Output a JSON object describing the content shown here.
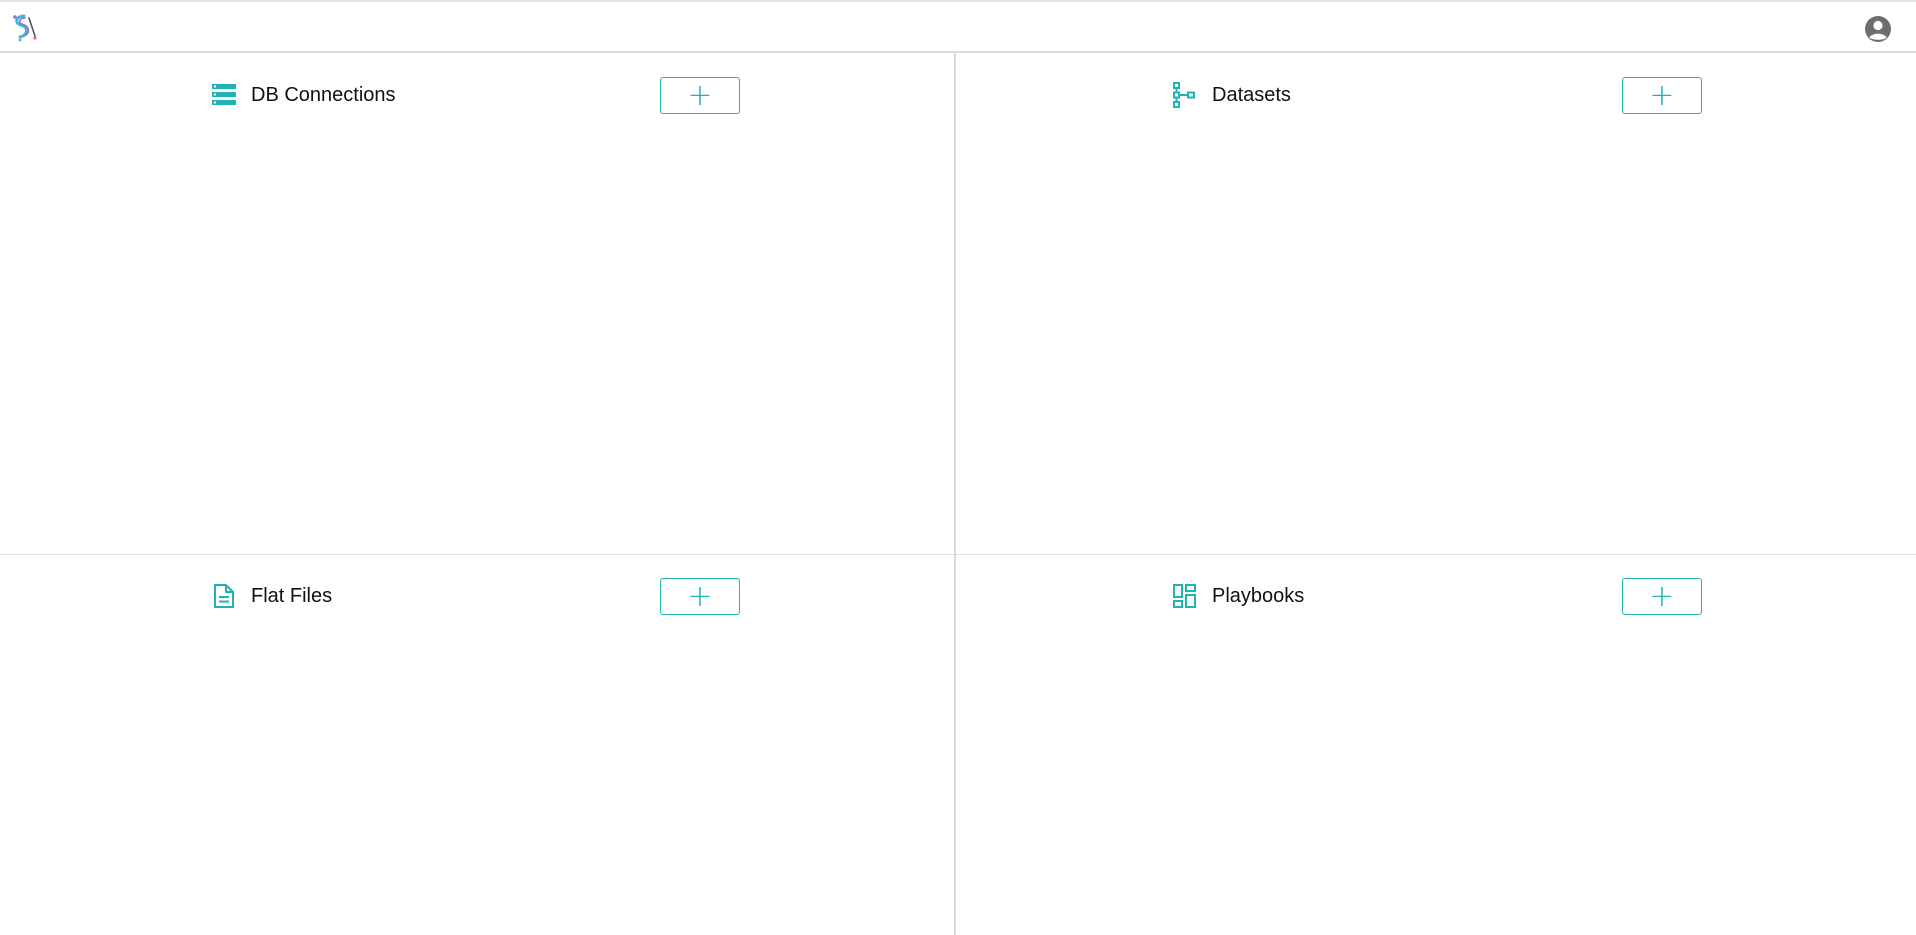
{
  "header": {
    "logo_icon": "app-logo",
    "user_icon": "user-account-icon",
    "accent_color": "#21b3b3"
  },
  "panels": [
    {
      "title": "DB Connections",
      "icon": "database-list-icon",
      "add_label": "+"
    },
    {
      "title": "Datasets",
      "icon": "hierarchy-tree-icon",
      "add_label": "+"
    },
    {
      "title": "Flat Files",
      "icon": "document-icon",
      "add_label": "+"
    },
    {
      "title": "Playbooks",
      "icon": "dashboard-layout-icon",
      "add_label": "+"
    }
  ]
}
